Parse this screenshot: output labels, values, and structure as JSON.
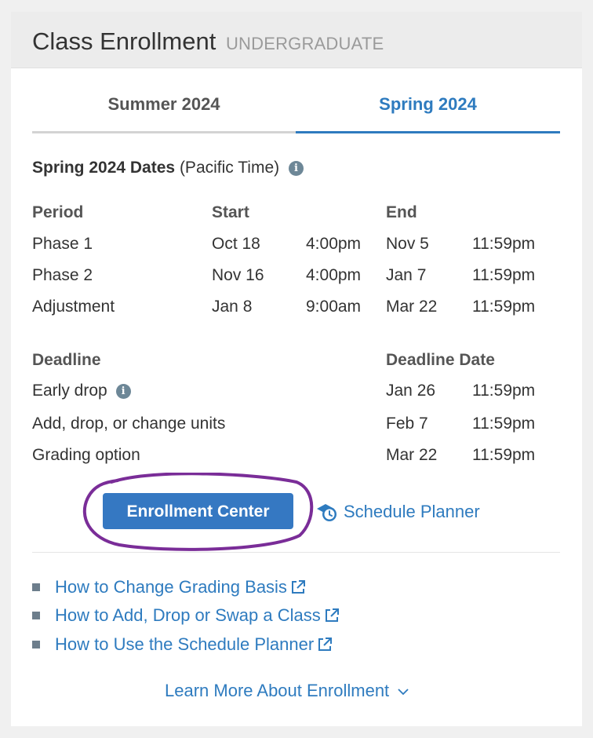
{
  "card": {
    "title": "Class Enrollment",
    "subtitle": "UNDERGRADUATE"
  },
  "tabs": [
    {
      "label": "Summer 2024",
      "active": false
    },
    {
      "label": "Spring 2024",
      "active": true
    }
  ],
  "dates": {
    "heading_bold": "Spring 2024 Dates",
    "heading_note": "(Pacific Time)",
    "columns": {
      "period": "Period",
      "start": "Start",
      "end": "End"
    },
    "rows": [
      {
        "period": "Phase 1",
        "start_date": "Oct 18",
        "start_time": "4:00pm",
        "end_date": "Nov 5",
        "end_time": "11:59pm"
      },
      {
        "period": "Phase 2",
        "start_date": "Nov 16",
        "start_time": "4:00pm",
        "end_date": "Jan 7",
        "end_time": "11:59pm"
      },
      {
        "period": "Adjustment",
        "start_date": "Jan 8",
        "start_time": "9:00am",
        "end_date": "Mar 22",
        "end_time": "11:59pm"
      }
    ]
  },
  "deadlines": {
    "columns": {
      "deadline": "Deadline",
      "date": "Deadline Date"
    },
    "rows": [
      {
        "name": "Early drop",
        "date": "Jan 26",
        "time": "11:59pm"
      },
      {
        "name": "Add, drop, or change units",
        "date": "Feb 7",
        "time": "11:59pm"
      },
      {
        "name": "Grading option",
        "date": "Mar 22",
        "time": "11:59pm"
      }
    ]
  },
  "actions": {
    "enrollment_center": "Enrollment Center",
    "schedule_planner": "Schedule Planner"
  },
  "help_links": [
    "How to Change Grading Basis",
    "How to Add, Drop or Swap a Class",
    "How to Use the Schedule Planner"
  ],
  "learn_more": "Learn More About Enrollment",
  "colors": {
    "link": "#2e7bbf",
    "button": "#3578c2",
    "annotation": "#7a2d98"
  }
}
